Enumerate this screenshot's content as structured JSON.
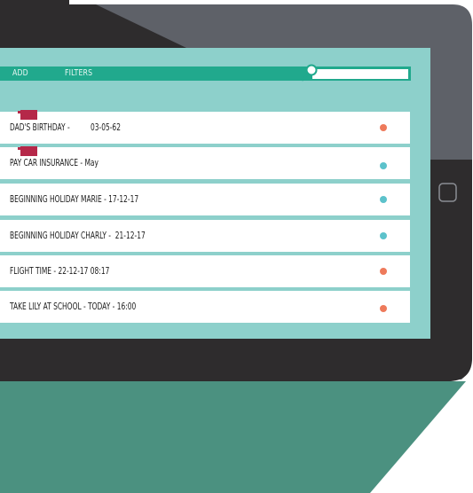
{
  "colors": {
    "tablet_body": "#2e2c2d",
    "tablet_right": "#5e6168",
    "screen": "#8dd0cb",
    "toolbar": "#21a98d",
    "floor": "#4b9180",
    "flag": "#b52849",
    "dot_orange": "#ee7a5b",
    "dot_teal": "#5cc2cb"
  },
  "toolbar": {
    "add_label": "ADD",
    "filters_label": "FILTERS",
    "search_value": "",
    "search_icon": "magnifier-icon"
  },
  "reminders": [
    {
      "text": "DAD'S BIRTHDAY -",
      "date": "03-05-62",
      "flagged": true,
      "dot": "orange"
    },
    {
      "text": "PAY CAR INSURANCE - May",
      "date": "",
      "flagged": true,
      "dot": "teal"
    },
    {
      "text": "BEGINNING HOLIDAY MARIE - 17-12-17",
      "date": "",
      "flagged": false,
      "dot": "teal"
    },
    {
      "text": "BEGINNING HOLIDAY CHARLY -  21-12-17",
      "date": "",
      "flagged": false,
      "dot": "teal"
    },
    {
      "text": "FLIGHT TIME - 22-12-17 08:17",
      "date": "",
      "flagged": false,
      "dot": "orange"
    },
    {
      "text": "TAKE LILY AT SCHOOL - TODAY - 16:00",
      "date": "",
      "flagged": false,
      "dot": "orange"
    }
  ]
}
